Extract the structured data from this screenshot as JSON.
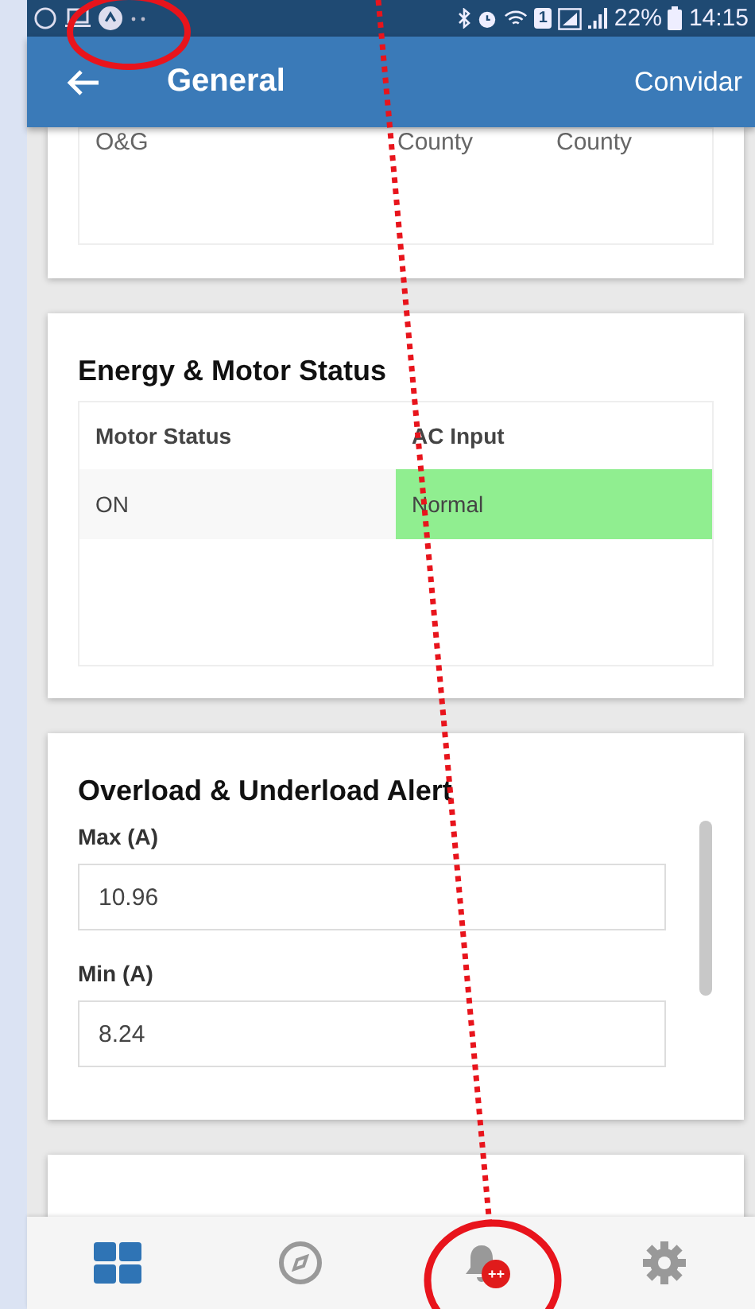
{
  "status_bar": {
    "battery": "22%",
    "time": "14:15",
    "sim_slot": "1"
  },
  "app_bar": {
    "title": "General",
    "action": "Convidar"
  },
  "cards": [
    {
      "kind": "table",
      "rows": [
        [
          "O&G",
          "",
          "County",
          "County"
        ],
        [
          "",
          "",
          "",
          ""
        ]
      ]
    },
    {
      "kind": "status",
      "title": "Energy & Motor Status",
      "columns": [
        "Motor Status",
        "AC Input"
      ],
      "rows": [
        [
          {
            "text": "ON"
          },
          {
            "text": "Normal",
            "color": "#90ee90"
          }
        ]
      ]
    },
    {
      "kind": "alert",
      "title": "Overload & Underload Alert",
      "fields": [
        {
          "label": "Max (A)",
          "value": "10.96"
        },
        {
          "label": "Min (A)",
          "value": "8.24"
        }
      ]
    },
    {
      "kind": "blank"
    }
  ],
  "bottom_nav": [
    {
      "kind": "grid",
      "selected": true
    },
    {
      "kind": "compass",
      "selected": false
    },
    {
      "kind": "bell",
      "selected": false,
      "badge": "++"
    },
    {
      "kind": "gear",
      "selected": false
    }
  ]
}
